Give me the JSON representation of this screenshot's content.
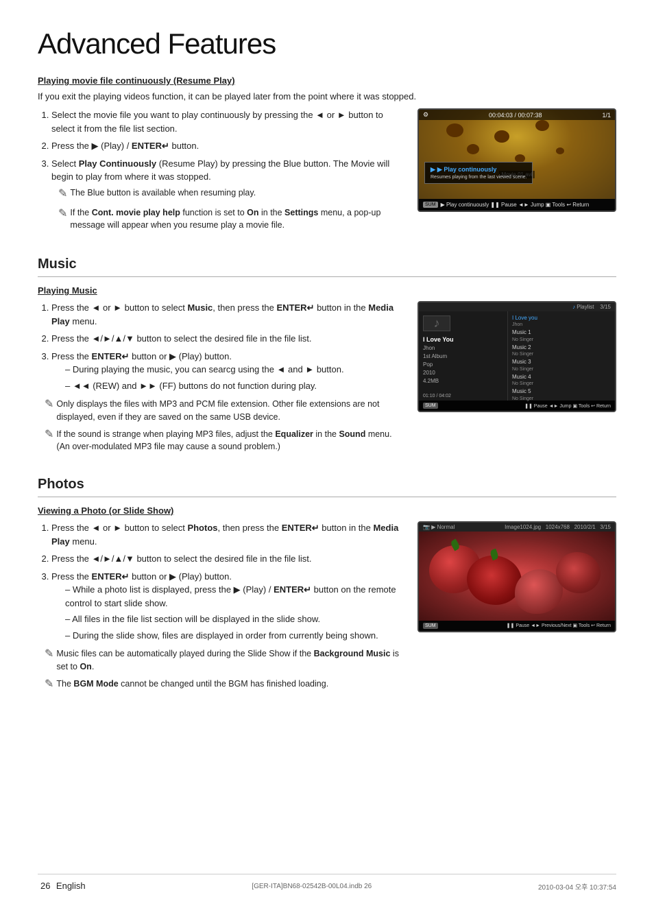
{
  "page": {
    "title": "Advanced Features",
    "footer": {
      "page_number": "26",
      "language": "English",
      "file_info": "[GER-ITA]BN68-02542B-00L04.indb   26",
      "date_info": "2010-03-04   오후 10:37:54"
    }
  },
  "section_movie": {
    "title": "",
    "subsection_title": "Playing movie file continuously (Resume Play)",
    "intro": "If you exit the playing videos function, it can be played later from the point where it was stopped.",
    "steps": [
      "Select the movie file you want to play continuously by pressing the ◄ or ► button to select it from the file list section.",
      "Press the ▶ (Play) / ENTER↵ button.",
      "Select Play Continuously (Resume Play) by pressing the Blue button. The Movie will begin to play from where it was stopped."
    ],
    "notes": [
      "The Blue button is available when resuming play.",
      "If the Cont. movie play help function is set to On in the Settings menu, a pop-up message will appear when you resume play a movie file."
    ],
    "tv": {
      "time": "00:04:03 / 00:07:38",
      "page": "1/1",
      "filename": "Movie 01.avi",
      "popup_title": "▶ Play continuously",
      "popup_desc": "Resumes playing from the last viewed scene.",
      "bottom": "▶ Play continuously  ❚❚ Pause  ◄► Jump  ▣ Tools  ↩ Return",
      "usb": "SUM"
    }
  },
  "section_music": {
    "title": "Music",
    "subsection_title": "Playing Music",
    "steps": [
      "Press the ◄ or ► button to select Music, then press the ENTER↵ button in the Media Play menu.",
      "Press the ◄/►/▲/▼ button to select the desired file in the file list.",
      "Press the ENTER↵ button or ▶ (Play) button."
    ],
    "dash_items": [
      "During playing the music, you can searcg using the ◄ and ► button.",
      "◄◄ (REW) and ►► (FF) buttons do not function during play."
    ],
    "notes": [
      "Only displays the files with MP3 and PCM file extension. Other file extensions are not displayed, even if they are saved on the same USB device.",
      "If the sound is strange when playing MP3 files, adjust the Equalizer in the Sound menu. (An over-modulated MP3 file may cause a sound problem.)"
    ],
    "screen": {
      "playlist_label": "Playlist",
      "page": "3/15",
      "song_title": "I Love You",
      "artist": "Jhon",
      "album": "1st Album",
      "genre": "Pop",
      "year": "2010",
      "size": "4.2MB",
      "time": "01:10 / 04:02",
      "tracks": [
        {
          "name": "I Love you",
          "sub": "Jhon"
        },
        {
          "name": "Music 1",
          "sub": "No Singer"
        },
        {
          "name": "Music 2",
          "sub": "No Singer"
        },
        {
          "name": "Music 3",
          "sub": "No Singer"
        },
        {
          "name": "Music 4",
          "sub": "No Singer"
        },
        {
          "name": "Music 5",
          "sub": "No Singer"
        }
      ],
      "usb": "SUM",
      "bottom": "❚❚ Pause  ◄► Jump  ▣ Tools  ↩ Return"
    }
  },
  "section_photos": {
    "title": "Photos",
    "subsection_title": "Viewing a Photo (or Slide Show)",
    "steps": [
      "Press the ◄ or ► button to select Photos, then press the ENTER↵ button in the Media Play menu.",
      "Press the ◄/►/▲/▼ button to select the desired file in the file list.",
      "Press the ENTER↵ button or ▶ (Play) button."
    ],
    "dash_items": [
      "While a photo list is displayed, press the ▶ (Play) / ENTER↵ button on the remote control to start slide show.",
      "All files in the file list section will be displayed in the slide show.",
      "During the slide show, files are displayed in order from currently being shown."
    ],
    "notes": [
      "Music files can be automatically played during the Slide Show if the Background Music is set to On.",
      "The BGM Mode cannot be changed until the BGM has finished loading."
    ],
    "screen": {
      "mode": "▶ Normal",
      "filename": "Image1024.jpg",
      "resolution": "1024x768",
      "date": "2010/2/1",
      "page": "3/15",
      "usb": "SUM",
      "bottom": "❚❚ Pause  ◄► Previous/Next  ▣ Tools  ↩ Return"
    }
  }
}
